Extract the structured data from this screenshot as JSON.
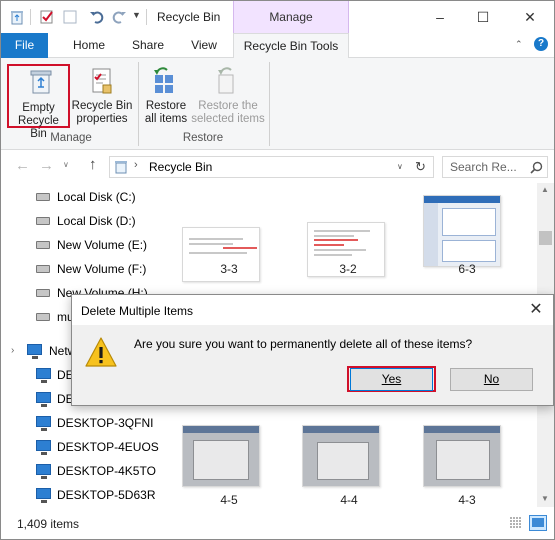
{
  "window": {
    "title": "Recycle Bin",
    "context_tab_group": "Manage"
  },
  "tabs": {
    "file": "File",
    "home": "Home",
    "share": "Share",
    "view": "View",
    "recycle_bin_tools": "Recycle Bin Tools"
  },
  "ribbon": {
    "empty_line1": "Empty",
    "empty_line2": "Recycle Bin",
    "properties_line1": "Recycle Bin",
    "properties_line2": "properties",
    "restore_all_line1": "Restore",
    "restore_all_line2": "all items",
    "restore_selected_line1": "Restore the",
    "restore_selected_line2": "selected items",
    "group_manage": "Manage",
    "group_restore": "Restore"
  },
  "address": {
    "location": "Recycle Bin",
    "search_placeholder": "Search Re..."
  },
  "nav_pane": {
    "items": [
      {
        "label": "Local Disk (C:)",
        "icon": "drive-icon"
      },
      {
        "label": "Local Disk (D:)",
        "icon": "drive-icon"
      },
      {
        "label": "New Volume (E:)",
        "icon": "drive-icon"
      },
      {
        "label": "New Volume (F:)",
        "icon": "drive-icon"
      },
      {
        "label": "New Volume (H:)",
        "icon": "drive-icon"
      },
      {
        "label": "mu",
        "icon": "drive-icon"
      },
      {
        "label": "Netw",
        "icon": "network-icon"
      },
      {
        "label": "DE",
        "icon": "computer-icon"
      },
      {
        "label": "DE",
        "icon": "computer-icon"
      },
      {
        "label": "DESKTOP-3QFNI",
        "icon": "computer-icon"
      },
      {
        "label": "DESKTOP-4EUOS",
        "icon": "computer-icon"
      },
      {
        "label": "DESKTOP-4K5TO",
        "icon": "computer-icon"
      },
      {
        "label": "DESKTOP-5D63R",
        "icon": "computer-icon"
      }
    ]
  },
  "content": {
    "row1": [
      "3-3",
      "3-2",
      "6-3"
    ],
    "row2": [
      "4-5",
      "4-4",
      "4-3"
    ]
  },
  "status": {
    "item_count": "1,409 items"
  },
  "dialog": {
    "title": "Delete Multiple Items",
    "message": "Are you sure you want to permanently delete all of these items?",
    "yes_label": "Yes",
    "no_label": "No",
    "close_glyph": "✕"
  },
  "colors": {
    "accent_blue": "#1979ca",
    "context_purple": "#f2e3ff",
    "highlight_red": "#d0102a"
  }
}
